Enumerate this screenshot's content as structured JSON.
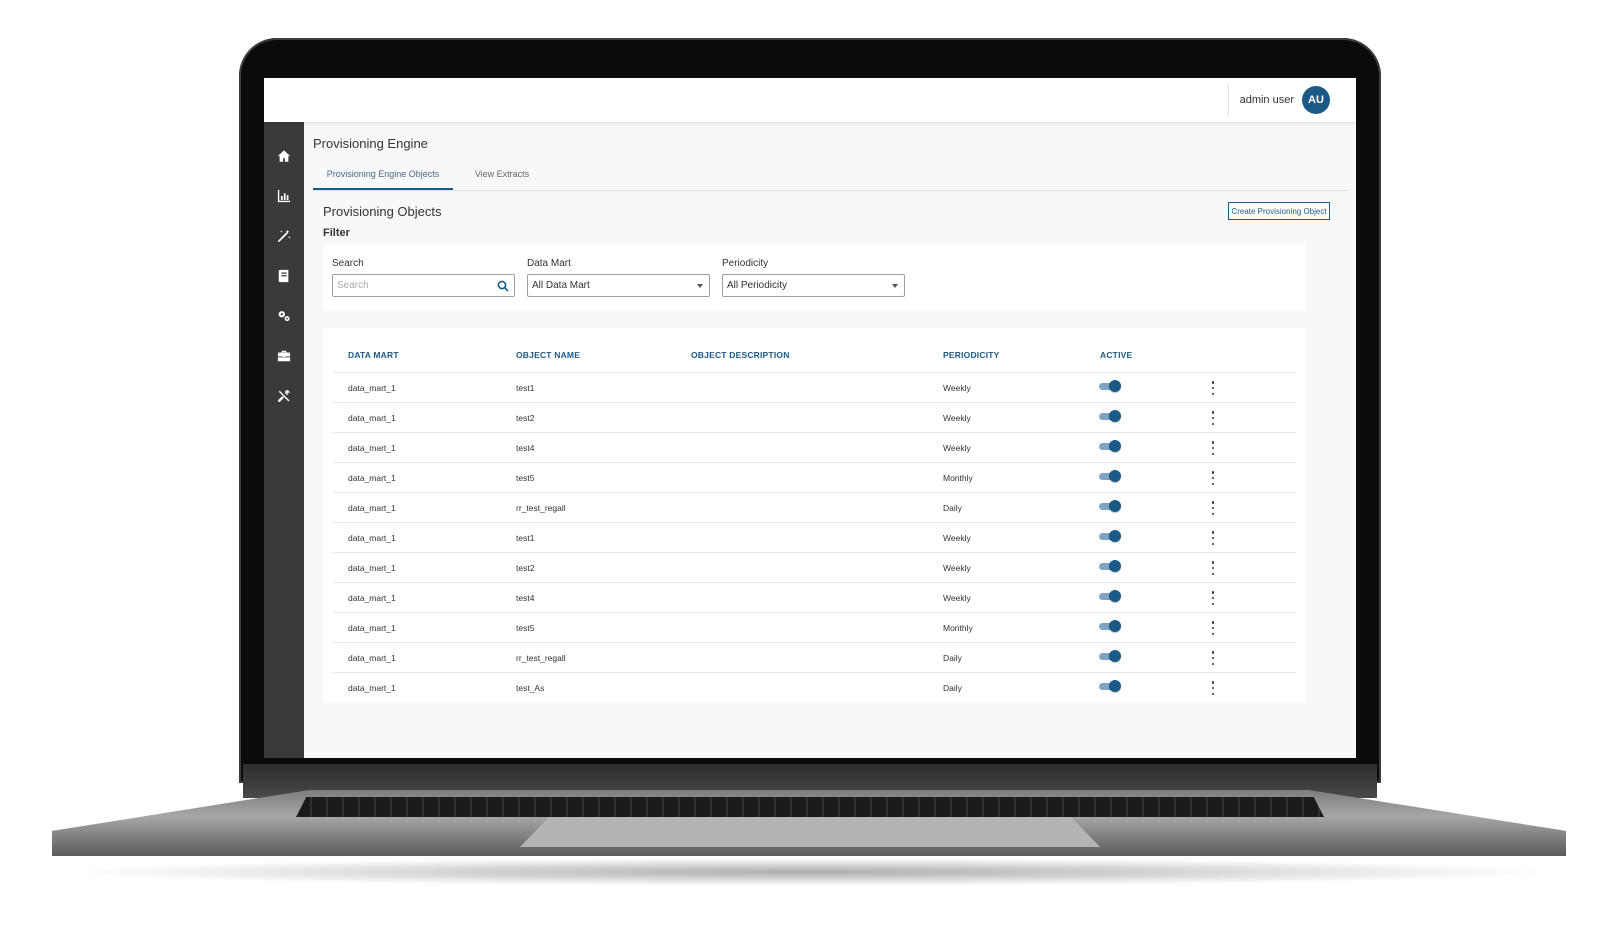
{
  "header": {
    "user_name": "admin user",
    "avatar_initials": "AU"
  },
  "sidebar": {
    "items": [
      {
        "icon": "home-icon"
      },
      {
        "icon": "bar-chart-icon"
      },
      {
        "icon": "magic-wand-icon"
      },
      {
        "icon": "book-icon"
      },
      {
        "icon": "gears-icon"
      },
      {
        "icon": "toolbox-icon"
      },
      {
        "icon": "tools-icon"
      }
    ]
  },
  "page": {
    "title": "Provisioning Engine",
    "tabs": [
      {
        "label": "Provisioning Engine Objects",
        "active": true
      },
      {
        "label": "View Extracts",
        "active": false
      }
    ],
    "section_title": "Provisioning Objects",
    "create_button": "Create Provisioning Object",
    "filter": {
      "label": "Filter",
      "search_label": "Search",
      "search_placeholder": "Search",
      "data_mart_label": "Data Mart",
      "data_mart_value": "All Data Mart",
      "periodicity_label": "Periodicity",
      "periodicity_value": "All Periodicity"
    }
  },
  "table": {
    "columns": [
      "DATA MART",
      "OBJECT NAME",
      "OBJECT DESCRIPTION",
      "PERIODICITY",
      "ACTIVE"
    ],
    "rows": [
      {
        "data_mart": "data_mart_1",
        "object_name": "test1",
        "description": "",
        "periodicity": "Weekly",
        "active": true
      },
      {
        "data_mart": "data_mart_1",
        "object_name": "test2",
        "description": "",
        "periodicity": "Weekly",
        "active": true
      },
      {
        "data_mart": "data_mart_1",
        "object_name": "test4",
        "description": "",
        "periodicity": "Weekly",
        "active": true
      },
      {
        "data_mart": "data_mart_1",
        "object_name": "test5",
        "description": "",
        "periodicity": "Monthly",
        "active": true
      },
      {
        "data_mart": "data_mart_1",
        "object_name": "rr_test_regall",
        "description": "",
        "periodicity": "Daily",
        "active": true
      },
      {
        "data_mart": "data_mart_1",
        "object_name": "test1",
        "description": "",
        "periodicity": "Weekly",
        "active": true
      },
      {
        "data_mart": "data_mart_1",
        "object_name": "test2",
        "description": "",
        "periodicity": "Weekly",
        "active": true
      },
      {
        "data_mart": "data_mart_1",
        "object_name": "test4",
        "description": "",
        "periodicity": "Weekly",
        "active": true
      },
      {
        "data_mart": "data_mart_1",
        "object_name": "test5",
        "description": "",
        "periodicity": "Monthly",
        "active": true
      },
      {
        "data_mart": "data_mart_1",
        "object_name": "rr_test_regall",
        "description": "",
        "periodicity": "Daily",
        "active": true
      },
      {
        "data_mart": "data_mart_1",
        "object_name": "test_As",
        "description": "",
        "periodicity": "Daily",
        "active": true
      }
    ]
  },
  "colors": {
    "accent": "#1b5a86",
    "sidebar_bg": "#3a3a3a",
    "toggle_track": "#7fa3c2"
  }
}
